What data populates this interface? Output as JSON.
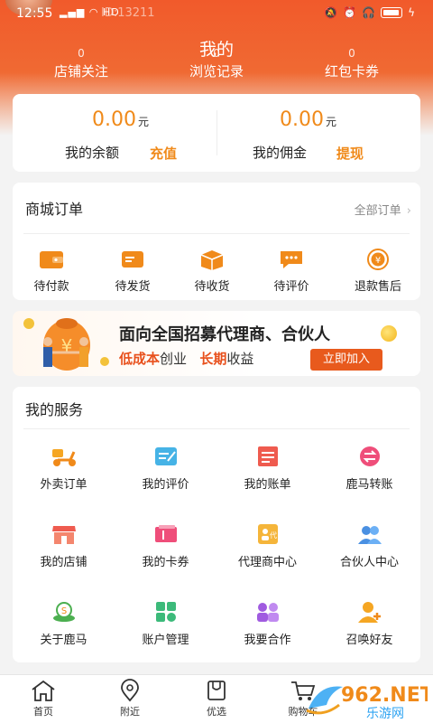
{
  "status_bar": {
    "time": "12:55",
    "network": "HD",
    "user_id": "ID:13211"
  },
  "header": {
    "title": "我的",
    "stats": [
      {
        "count": "0",
        "label": "店铺关注"
      },
      {
        "count": "0",
        "label": "浏览记录"
      },
      {
        "count": "0",
        "label": "红包卡券"
      }
    ]
  },
  "wallet": {
    "balance": {
      "amount": "0.00",
      "unit": "元",
      "label": "我的余额",
      "action": "充值"
    },
    "commission": {
      "amount": "0.00",
      "unit": "元",
      "label": "我的佣金",
      "action": "提现"
    }
  },
  "orders": {
    "title": "商城订单",
    "all_link": "全部订单",
    "items": [
      {
        "label": "待付款",
        "icon": "wallet-icon"
      },
      {
        "label": "待发货",
        "icon": "card-icon"
      },
      {
        "label": "待收货",
        "icon": "box-icon"
      },
      {
        "label": "待评价",
        "icon": "comment-icon"
      },
      {
        "label": "退款售后",
        "icon": "refund-icon"
      }
    ]
  },
  "banner": {
    "title": "面向全国招募代理商、合伙人",
    "sub_hl1": "低成本",
    "sub_t1": "创业",
    "sub_hl2": "长期",
    "sub_t2": "收益",
    "button": "立即加入"
  },
  "services": {
    "title": "我的服务",
    "items": [
      {
        "label": "外卖订单",
        "icon": "scooter-icon"
      },
      {
        "label": "我的评价",
        "icon": "edit-icon"
      },
      {
        "label": "我的账单",
        "icon": "bill-icon"
      },
      {
        "label": "鹿马转账",
        "icon": "transfer-icon"
      },
      {
        "label": "我的店铺",
        "icon": "store-icon"
      },
      {
        "label": "我的卡券",
        "icon": "coupon-icon"
      },
      {
        "label": "代理商中心",
        "icon": "agent-icon"
      },
      {
        "label": "合伙人中心",
        "icon": "partners-icon"
      },
      {
        "label": "关于鹿马",
        "icon": "info-icon"
      },
      {
        "label": "账户管理",
        "icon": "account-icon"
      },
      {
        "label": "我要合作",
        "icon": "cooperate-icon"
      },
      {
        "label": "召唤好友",
        "icon": "invite-icon"
      }
    ]
  },
  "bottom_nav": [
    {
      "label": "首页",
      "icon": "home-icon"
    },
    {
      "label": "附近",
      "icon": "location-icon"
    },
    {
      "label": "优选",
      "icon": "bag-icon"
    },
    {
      "label": "购物车",
      "icon": "cart-icon"
    }
  ],
  "watermark": {
    "brand": "962.NET",
    "sub": "乐游网"
  },
  "colors": {
    "header": "#f15a2b",
    "accent": "#f08a1a",
    "button": "#e85a1d"
  }
}
